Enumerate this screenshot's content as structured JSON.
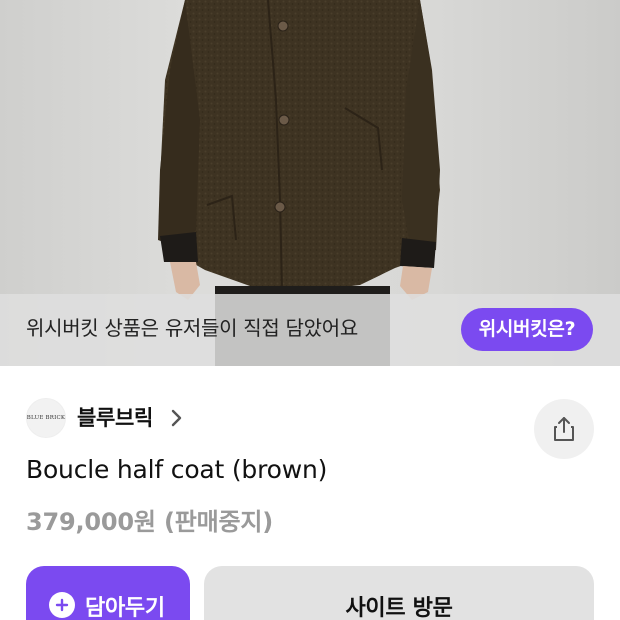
{
  "hero": {
    "image_alt": "brown boucle half coat worn by model"
  },
  "wishbar": {
    "text": "위시버킷 상품은 유저들이 직접 담았어요",
    "button_label": "위시버킷은?"
  },
  "brand": {
    "logo_text": "BLUE BRICK",
    "name": "블루브릭"
  },
  "product": {
    "title": "Boucle half coat (brown)",
    "price": "379,000원",
    "status": "(판매중지)"
  },
  "actions": {
    "save_label": "담아두기",
    "visit_label": "사이트 방문"
  },
  "colors": {
    "accent": "#7b4af0",
    "price_gray": "#9a9a9a",
    "coat": "#3f3424"
  },
  "icons": {
    "brand_chevron": "chevron-right-icon",
    "share": "share-icon",
    "save": "plus-circle-icon"
  }
}
